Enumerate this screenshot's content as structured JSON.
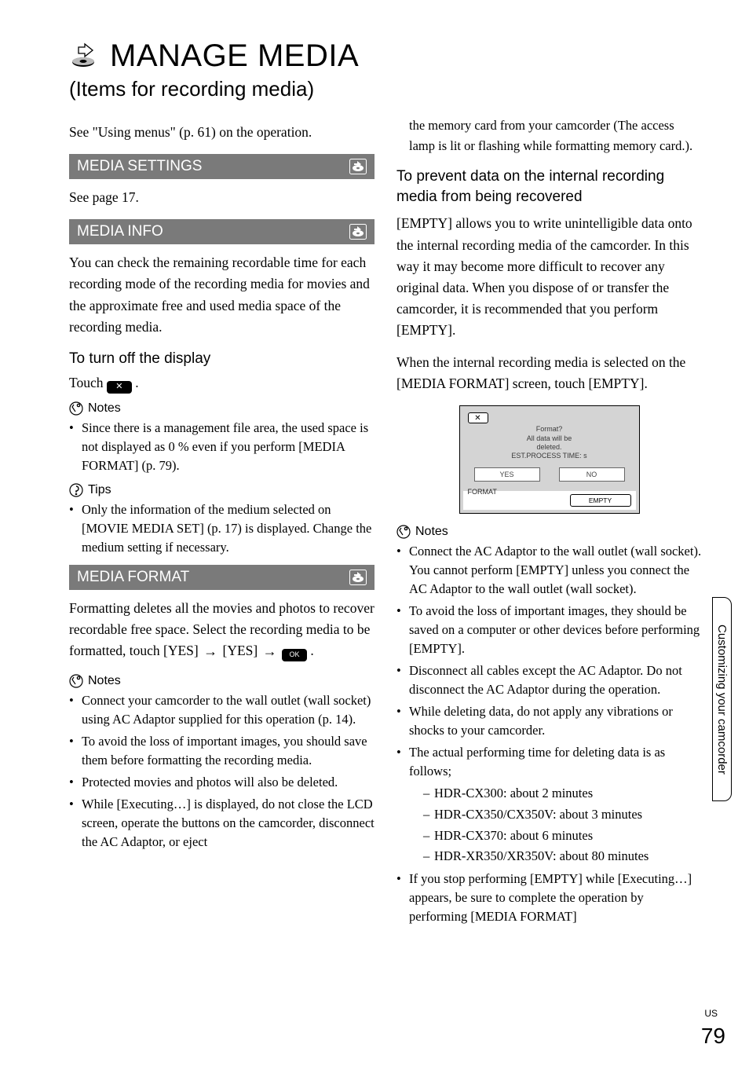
{
  "title": "MANAGE MEDIA",
  "subtitle": "(Items for recording media)",
  "intro": "See \"Using menus\" (p. 61) on the operation.",
  "sectionBar1": "MEDIA SETTINGS",
  "seePage17": "See page 17.",
  "sectionBar2": "MEDIA INFO",
  "mediaInfoBody": "You can check the remaining recordable time for each recording mode of the recording media for movies and the approximate free and used media space of the recording media.",
  "turnOffHeading": "To turn off the display",
  "touchLabel": "Touch ",
  "notesLabel": "Notes",
  "tipsLabel": "Tips",
  "notes1": {
    "n1": "Since there is a management file area, the used space is not displayed as 0 % even if you perform [MEDIA FORMAT] (p. 79)."
  },
  "tips1": {
    "t1": "Only the information of the medium selected on [MOVIE MEDIA SET] (p. 17) is displayed. Change the medium setting if necessary."
  },
  "sectionBar3": "MEDIA FORMAT",
  "mediaFormatBody": "Formatting deletes all the movies and photos to recover recordable free space. Select the recording media to be formatted, touch [YES] ",
  "yesLabel": " [YES] ",
  "notes2": {
    "n1": "Connect your camcorder to the wall outlet (wall socket) using AC Adaptor supplied for this operation (p. 14).",
    "n2": "To avoid the loss of important images, you should save them before formatting the recording media.",
    "n3": "Protected movies and photos will also be deleted.",
    "n4": "While [Executing…] is displayed, do not close the LCD screen, operate the buttons on the camcorder, disconnect the AC Adaptor, or eject"
  },
  "col2top": "the memory card from your camcorder (The access lamp is lit or flashing while formatting memory card.).",
  "preventHeading": "To prevent data on the internal recording media from being recovered",
  "emptyBody": "[EMPTY] allows you to write unintelligible data onto the internal recording media of the camcorder. In this way it may become more difficult to recover any original data. When you dispose of or transfer the camcorder, it is recommended that you perform [EMPTY].",
  "whenSelectedBody": "When the internal recording media is selected on the [MEDIA FORMAT] screen, touch [EMPTY].",
  "screen": {
    "x": "✕",
    "l1": "Format?",
    "l2": "All data will be",
    "l3": "deleted.",
    "l4": "EST.PROCESS TIME:   s",
    "yes": "YES",
    "no": "NO",
    "format": "FORMAT",
    "empty": "EMPTY"
  },
  "notes3": {
    "n1": "Connect the AC Adaptor to the wall outlet (wall socket). You cannot perform [EMPTY] unless you connect the AC Adaptor to the wall outlet (wall socket).",
    "n2": "To avoid the loss of important images, they should be saved on a computer or other devices before performing [EMPTY].",
    "n3": "Disconnect all cables except the AC Adaptor. Do not disconnect the AC Adaptor during the operation.",
    "n4": "While deleting data, do not apply any vibrations or shocks to your camcorder.",
    "n5": "The actual performing time for deleting data is as follows;",
    "d1": "HDR-CX300: about 2 minutes",
    "d2": "HDR-CX350/CX350V: about 3 minutes",
    "d3": "HDR-CX370: about 6 minutes",
    "d4": "HDR-XR350/XR350V: about 80 minutes",
    "n6": "If you stop performing [EMPTY] while [Executing…] appears, be sure to complete the operation by performing [MEDIA FORMAT]"
  },
  "sideTab": "Customizing your camcorder",
  "footerUS": "US",
  "footerNum": "79",
  "period": "."
}
